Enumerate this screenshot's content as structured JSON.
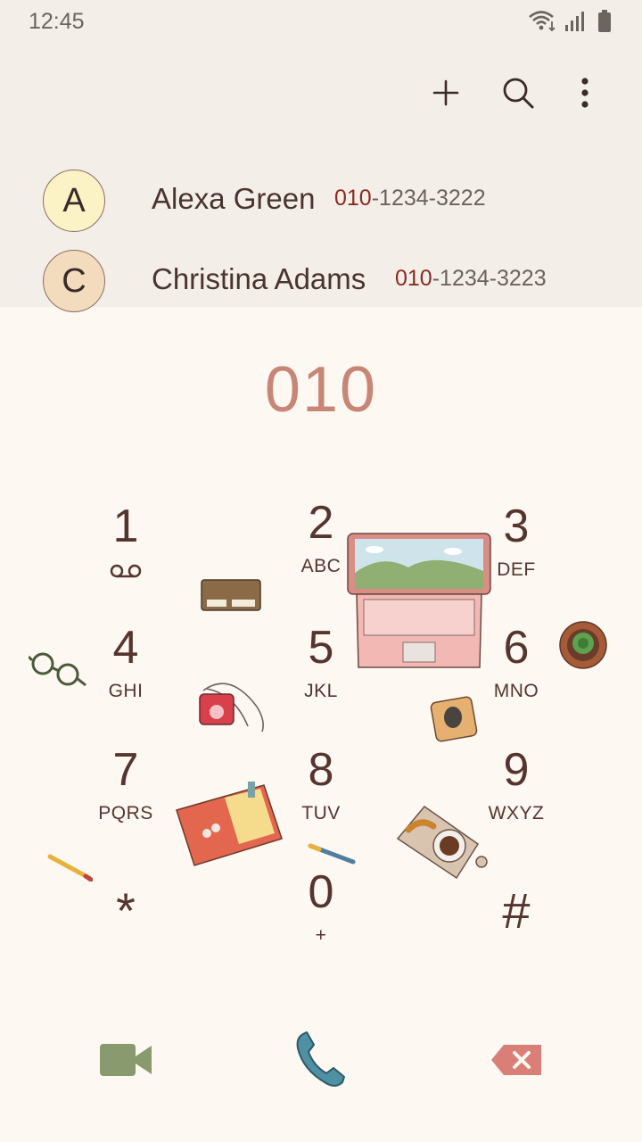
{
  "status_bar": {
    "time": "12:45",
    "icons": [
      "wifi-icon",
      "signal-icon",
      "battery-icon"
    ]
  },
  "toolbar": {
    "actions": [
      "add-icon",
      "search-icon",
      "more-vert-icon"
    ]
  },
  "contacts": [
    {
      "initial": "A",
      "name": "Alexa Green",
      "number_match": "010",
      "number_rest": "-1234-3222",
      "avatar_color": "#fbf2c5"
    },
    {
      "initial": "C",
      "name": "Christina Adams",
      "number_match": "010",
      "number_rest": "-1234-3223",
      "avatar_color": "#f3dcbd"
    }
  ],
  "dialer": {
    "entered": "010",
    "keys": [
      {
        "digit": "1",
        "letters": "",
        "icon": "voicemail-icon"
      },
      {
        "digit": "2",
        "letters": "ABC"
      },
      {
        "digit": "3",
        "letters": "DEF"
      },
      {
        "digit": "4",
        "letters": "GHI"
      },
      {
        "digit": "5",
        "letters": "JKL"
      },
      {
        "digit": "6",
        "letters": "MNO"
      },
      {
        "digit": "7",
        "letters": "PQRS"
      },
      {
        "digit": "8",
        "letters": "TUV"
      },
      {
        "digit": "9",
        "letters": "WXYZ"
      },
      {
        "digit": "*",
        "letters": ""
      },
      {
        "digit": "0",
        "letters": "+"
      },
      {
        "digit": "#",
        "letters": ""
      }
    ]
  },
  "actions": {
    "video_call_icon": "video-camera-icon",
    "call_icon": "phone-icon",
    "backspace_icon": "backspace-icon"
  },
  "colors": {
    "top_bg": "#f3efe8",
    "dialpad_bg": "#fdf8f1",
    "entered_number": "#c88676",
    "key_text": "#56352f",
    "video_icon": "#8a9a6f",
    "call_icon": "#4f90a3",
    "backspace_icon": "#d97f78"
  }
}
